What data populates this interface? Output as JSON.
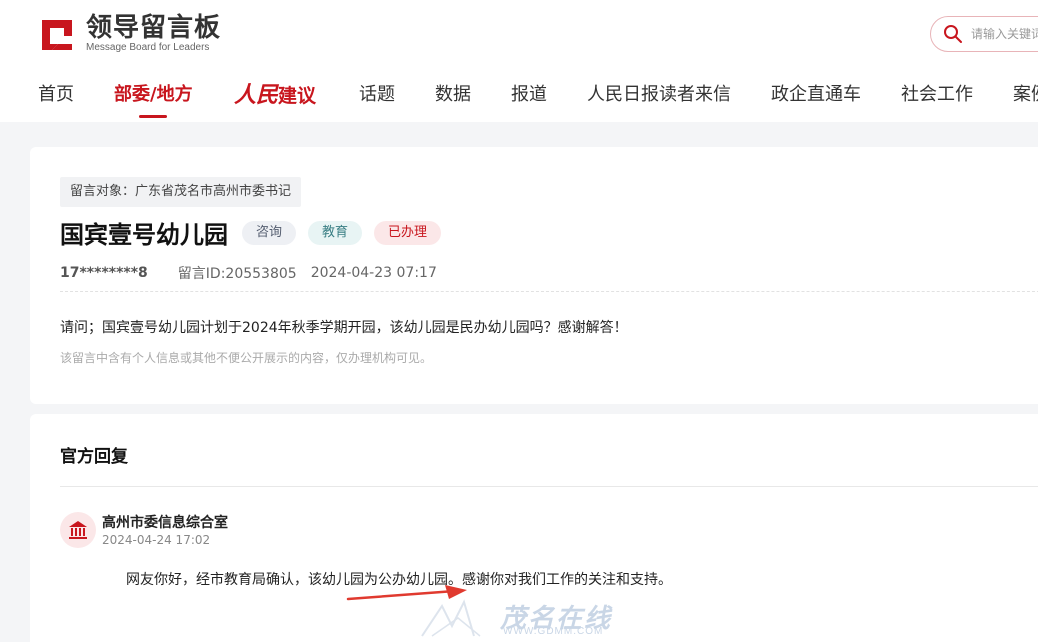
{
  "header": {
    "logo_title": "领导留言板",
    "logo_subtitle": "Message Board for Leaders",
    "search_placeholder": "请输入关键词"
  },
  "nav": {
    "items": [
      {
        "label": "首页"
      },
      {
        "label": "部委/地方",
        "active": true
      },
      {
        "label_script": "人民",
        "label_rest": "建议"
      },
      {
        "label": "话题"
      },
      {
        "label": "数据"
      },
      {
        "label": "报道"
      },
      {
        "label": "人民日报读者来信"
      },
      {
        "label": "政企直通车"
      },
      {
        "label": "社会工作"
      },
      {
        "label": "案例"
      }
    ]
  },
  "message": {
    "target": "留言对象：广东省茂名市高州市委书记",
    "title": "国宾壹号幼儿园",
    "badges": [
      "咨询",
      "教育",
      "已办理"
    ],
    "user": "17********8",
    "id_label": "留言ID:20553805",
    "time": "2024-04-23 07:17",
    "content": "请问；国宾壹号幼儿园计划于2024年秋季学期开园，该幼儿园是民办幼儿园吗？感谢解答！",
    "note": "该留言中含有个人信息或其他不便公开展示的内容，仅办理机构可见。"
  },
  "reply": {
    "heading": "官方回复",
    "org": "高州市委信息综合室",
    "time": "2024-04-24 17:02",
    "text": "网友你好，经市教育局确认，该幼儿园为公办幼儿园。感谢你对我们工作的关注和支持。"
  },
  "watermark": {
    "text": "茂名在线",
    "url": "WWW.GDMM.COM"
  },
  "colors": {
    "brand_red": "#c8161e",
    "page_bg": "#f4f5f7"
  }
}
